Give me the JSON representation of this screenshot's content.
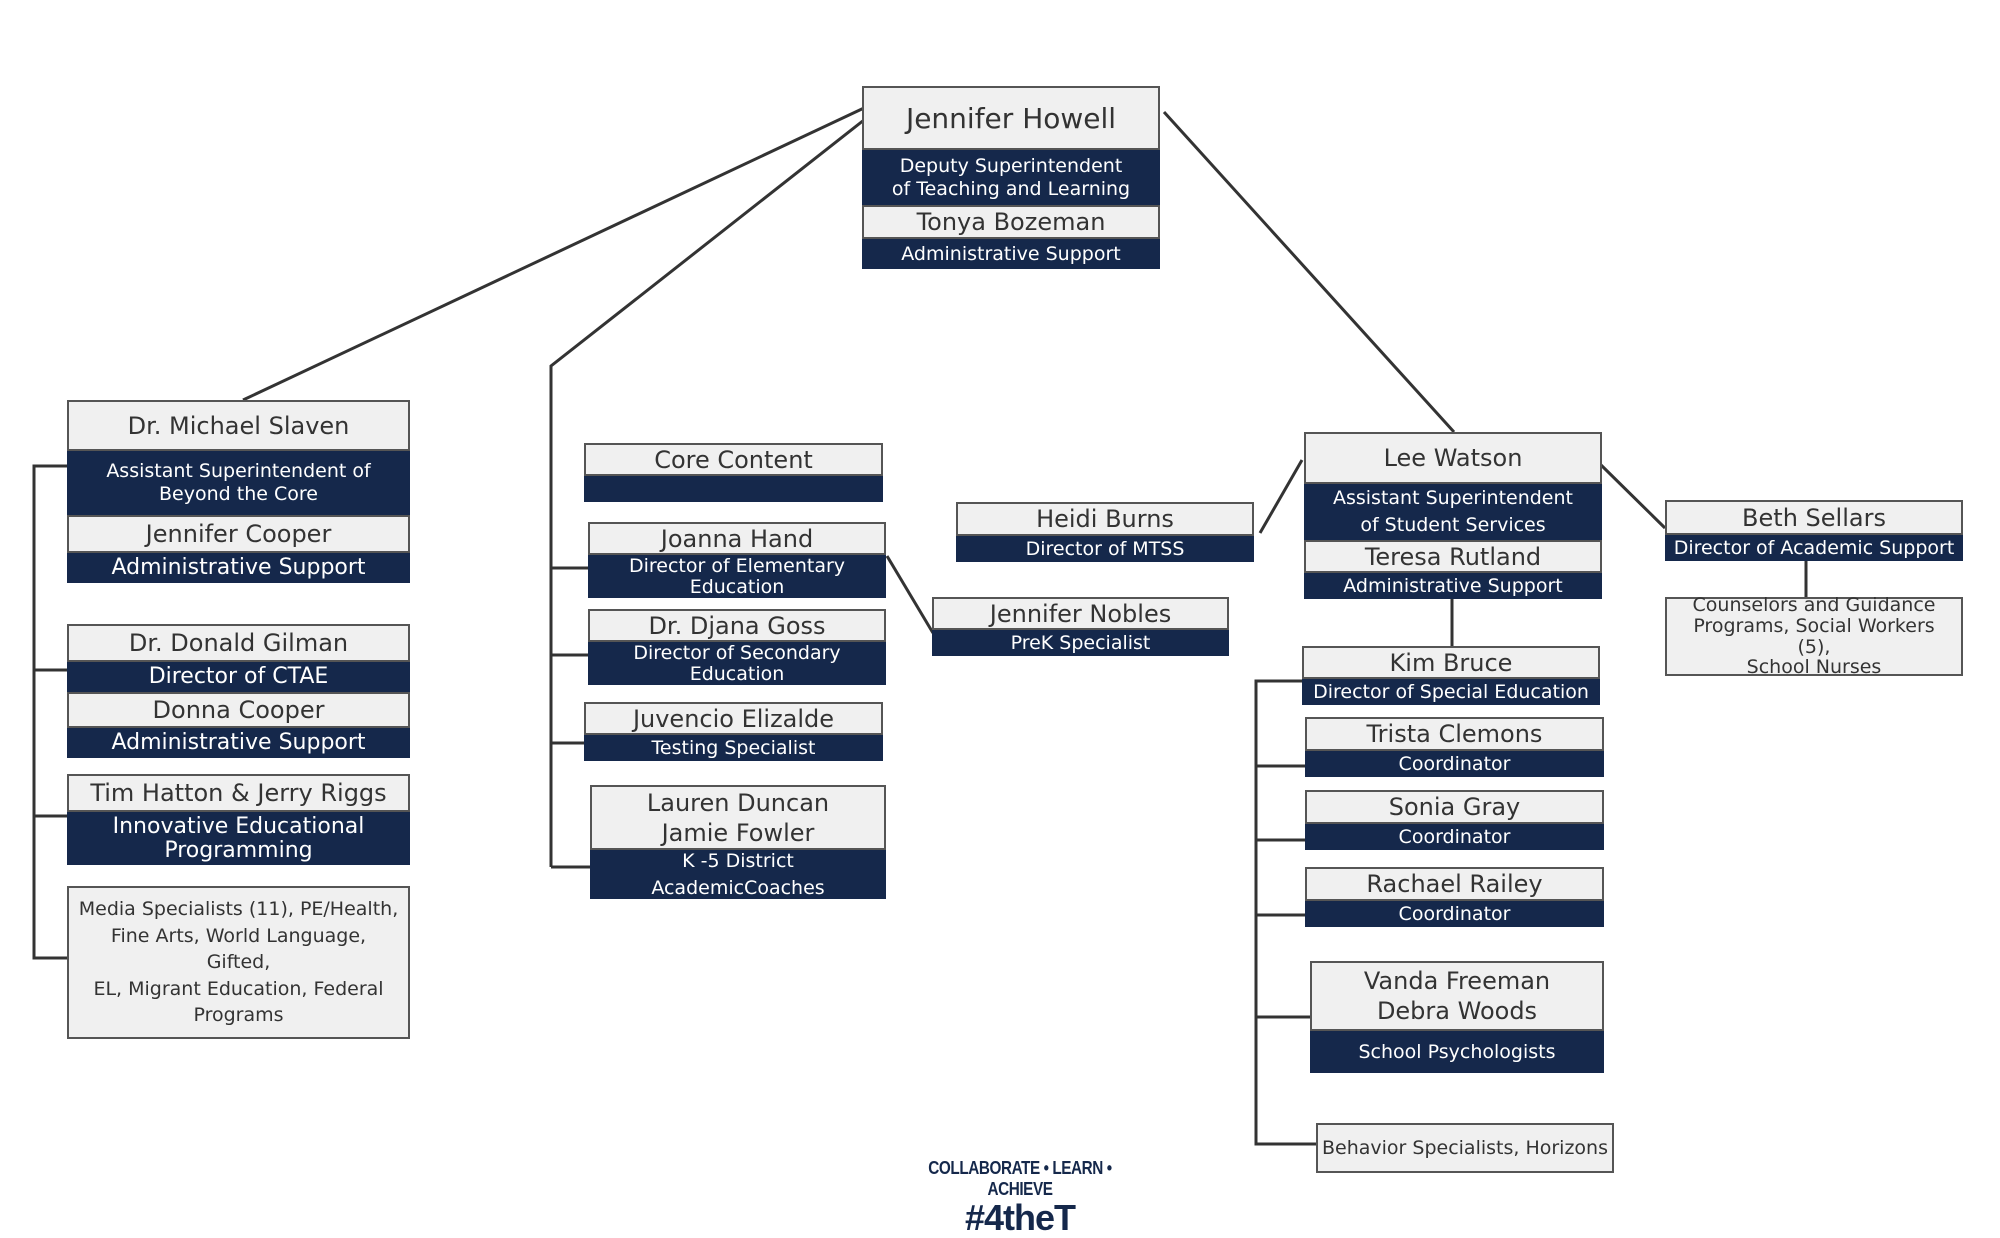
{
  "top": {
    "name": "Jennifer Howell",
    "title": "Deputy Superintendent\nof Teaching and Learning",
    "support_name": "Tonya Bozeman",
    "support_title": "Administrative Support"
  },
  "beyond_core": {
    "head": {
      "name": "Dr. Michael Slaven",
      "title": "Assistant Superintendent of\nBeyond the Core",
      "support_name": "Jennifer Cooper",
      "support_title": "Administrative Support"
    },
    "ctae": {
      "name": "Dr. Donald Gilman",
      "title": "Director of CTAE",
      "support_name": "Donna Cooper",
      "support_title": "Administrative Support"
    },
    "innovative": {
      "name": "Tim Hatton & Jerry Riggs",
      "title": "Innovative Educational\nProgramming"
    },
    "programs": "Media Specialists (11), PE/Health,\nFine Arts, World Language, Gifted,\nEL, Migrant Education, Federal\nPrograms"
  },
  "core": {
    "header": {
      "name": "Core Content",
      "title": ""
    },
    "elementary": {
      "name": "Joanna Hand",
      "title": "Director of Elementary\nEducation"
    },
    "secondary": {
      "name": "Dr. Djana Goss",
      "title": "Director of Secondary\nEducation"
    },
    "testing": {
      "name": "Juvencio Elizalde",
      "title": "Testing Specialist"
    },
    "coaches": {
      "name": "Lauren Duncan\nJamie Fowler",
      "title": "K -5 District\nAcademicCoaches"
    },
    "prek": {
      "name": "Jennifer Nobles",
      "title": "PreK Specialist"
    }
  },
  "student_services": {
    "head": {
      "name": "Lee Watson",
      "title": "Assistant Superintendent\nof Student Services",
      "support_name": "Teresa Rutland",
      "support_title": "Administrative Support"
    },
    "mtss": {
      "name": "Heidi Burns",
      "title": "Director of MTSS"
    },
    "academic_support": {
      "name": "Beth Sellars",
      "title": "Director of Academic Support"
    },
    "counselors": "Counselors and Guidance\nPrograms, Social Workers (5),\nSchool Nurses",
    "sped": {
      "name": "Kim Bruce",
      "title": "Director of Special Education"
    },
    "coordinators": [
      {
        "name": "Trista Clemons",
        "title": "Coordinator"
      },
      {
        "name": "Sonia Gray",
        "title": "Coordinator"
      },
      {
        "name": "Rachael Railey",
        "title": "Coordinator"
      }
    ],
    "psychologists": {
      "name": "Vanda Freeman\nDebra Woods",
      "title": "School Psychologists"
    },
    "behavior": "Behavior Specialists, Horizons"
  },
  "footer": {
    "tagline": "COLLABORATE • LEARN • ACHIEVE",
    "hashtag": "#4theT"
  },
  "colors": {
    "navy": "#15284b",
    "box_fill": "#f0f0f0",
    "line": "#333333"
  }
}
